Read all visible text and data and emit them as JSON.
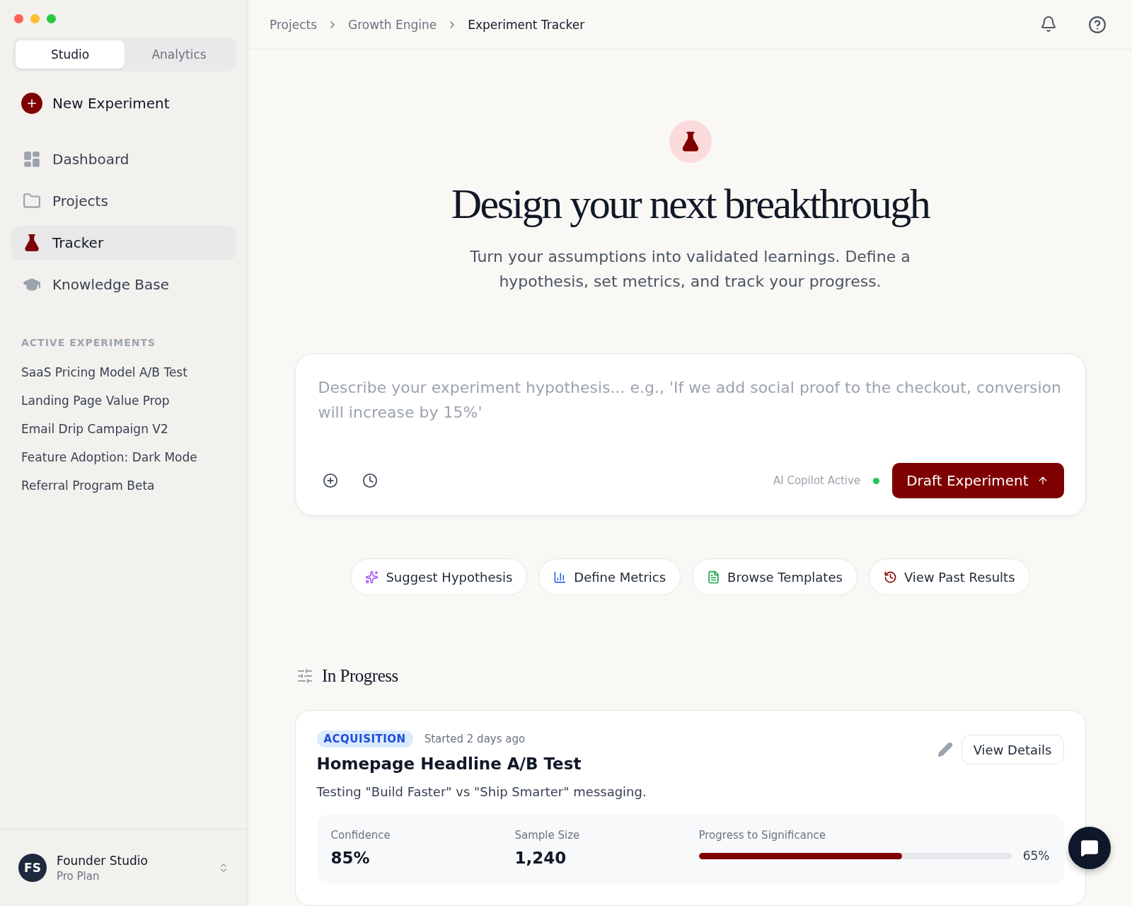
{
  "sidebar": {
    "mode_tabs": [
      {
        "label": "Studio",
        "selected": true
      },
      {
        "label": "Analytics",
        "selected": false
      }
    ],
    "new_button": "New Experiment",
    "nav": [
      {
        "label": "Dashboard",
        "selected": false
      },
      {
        "label": "Projects",
        "selected": false
      },
      {
        "label": "Tracker",
        "selected": true
      },
      {
        "label": "Knowledge Base",
        "selected": false
      }
    ],
    "active_heading": "ACTIVE EXPERIMENTS",
    "active_items": [
      "SaaS Pricing Model A/B Test",
      "Landing Page Value Prop",
      "Email Drip Campaign V2",
      "Feature Adoption: Dark Mode",
      "Referral Program Beta"
    ],
    "account": {
      "initials": "FS",
      "name": "Founder Studio",
      "plan": "Pro Plan"
    }
  },
  "breadcrumbs": [
    {
      "label": "Projects",
      "current": false
    },
    {
      "label": "Growth Engine",
      "current": false
    },
    {
      "label": "Experiment Tracker",
      "current": true
    }
  ],
  "hero": {
    "title": "Design your next breakthrough",
    "subtitle": "Turn your assumptions into validated learnings. Define a hypothesis, set metrics, and track your progress."
  },
  "composer": {
    "placeholder": "Describe your experiment hypothesis... e.g., 'If we add social proof to the checkout, conversion will increase by 15%'",
    "status": "AI Copilot Active",
    "copilot_on": true,
    "submit": "Draft Experiment"
  },
  "quick_actions": [
    "Suggest Hypothesis",
    "Define Metrics",
    "Browse Templates",
    "View Past Results"
  ],
  "section_title": "In Progress",
  "experiments": [
    {
      "tag": "ACQUISITION",
      "started": "Started 2 days ago",
      "title": "Homepage Headline A/B Test",
      "description": "Testing \"Build Faster\" vs \"Ship Smarter\" messaging.",
      "action": "View Details",
      "metrics": [
        {
          "label": "Confidence",
          "value": "85%"
        },
        {
          "label": "Sample Size",
          "value": "1,240"
        }
      ],
      "progress": {
        "label": "Progress to Significance",
        "level": 0.65,
        "reading": "65%"
      }
    }
  ]
}
